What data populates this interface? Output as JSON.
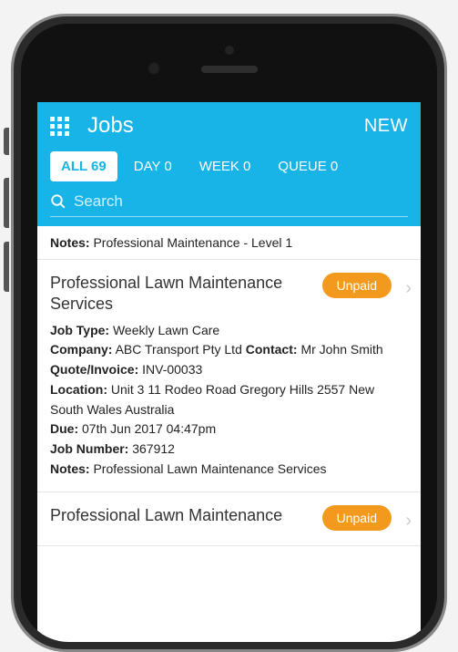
{
  "header": {
    "title": "Jobs",
    "new_label": "NEW"
  },
  "tabs": [
    {
      "label": "ALL 69",
      "active": true
    },
    {
      "label": "DAY 0",
      "active": false
    },
    {
      "label": "WEEK 0",
      "active": false
    },
    {
      "label": "QUEUE 0",
      "active": false
    }
  ],
  "search": {
    "placeholder": "Search",
    "value": ""
  },
  "top_notes": {
    "label": "Notes:",
    "text": "Professional Maintenance - Level 1"
  },
  "labels": {
    "job_type": "Job Type:",
    "company": "Company:",
    "contact": "Contact:",
    "quote_invoice": "Quote/Invoice:",
    "location": "Location:",
    "due": "Due:",
    "job_number": "Job Number:",
    "notes": "Notes:"
  },
  "jobs": [
    {
      "title": "Professional Lawn Maintenance Services",
      "status": "Unpaid",
      "job_type": "Weekly Lawn Care",
      "company": "ABC Transport Pty Ltd",
      "contact": "Mr John Smith",
      "quote_invoice": "INV-00033",
      "location": "Unit 3 11 Rodeo Road Gregory Hills 2557 New South Wales Australia",
      "due": "07th Jun 2017 04:47pm",
      "job_number": "367912",
      "notes": "Professional Lawn Maintenance Services"
    },
    {
      "title": "Professional Lawn Maintenance",
      "status": "Unpaid"
    }
  ]
}
